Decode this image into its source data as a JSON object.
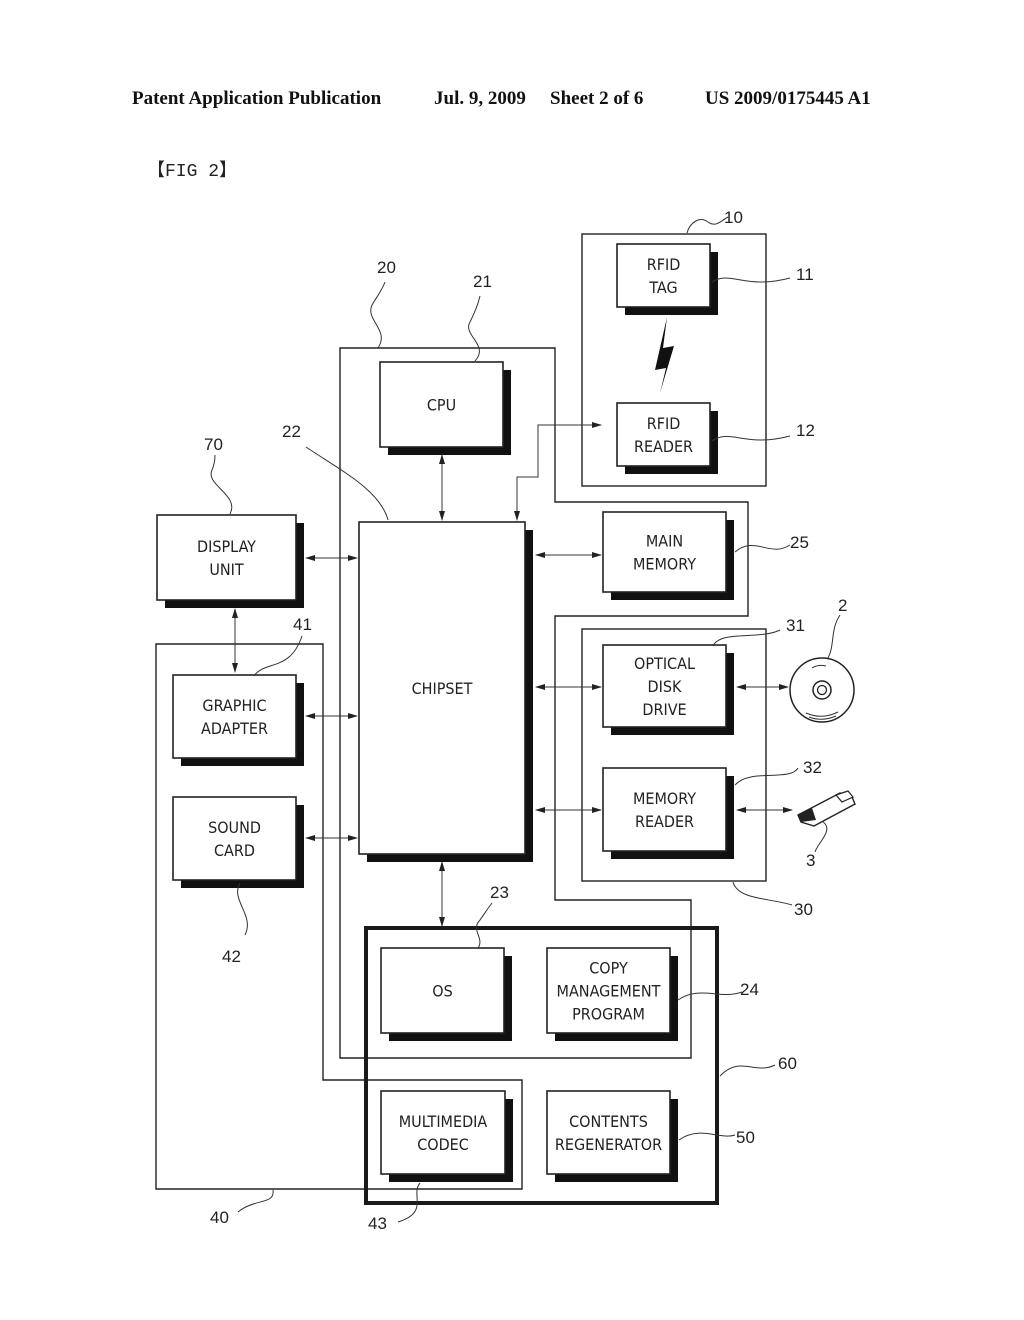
{
  "header": {
    "publication": "Patent Application Publication",
    "date": "Jul. 9, 2009",
    "sheet": "Sheet 2 of 6",
    "number": "US 2009/0175445 A1"
  },
  "figure_label": "【FIG 2】",
  "blocks": {
    "rfid_tag": {
      "lines": [
        "RFID",
        "TAG"
      ],
      "ref": "11"
    },
    "rfid_reader": {
      "lines": [
        "RFID",
        "READER"
      ],
      "ref": "12"
    },
    "cpu": {
      "lines": [
        "CPU"
      ],
      "ref": "21"
    },
    "chipset": {
      "lines": [
        "CHIPSET"
      ],
      "ref": "22"
    },
    "os": {
      "lines": [
        "OS"
      ],
      "ref": "23"
    },
    "copy_management": {
      "lines": [
        "COPY",
        "MANAGEMENT",
        "PROGRAM"
      ],
      "ref": "24"
    },
    "main_memory": {
      "lines": [
        "MAIN",
        "MEMORY"
      ],
      "ref": "25"
    },
    "optical_disk_drive": {
      "lines": [
        "OPTICAL",
        "DISK",
        "DRIVE"
      ],
      "ref": "31"
    },
    "memory_reader": {
      "lines": [
        "MEMORY",
        "READER"
      ],
      "ref": "32"
    },
    "graphic_adapter": {
      "lines": [
        "GRAPHIC",
        "ADAPTER"
      ],
      "ref": "41"
    },
    "sound_card": {
      "lines": [
        "SOUND",
        "CARD"
      ],
      "ref": "42"
    },
    "multimedia_codec": {
      "lines": [
        "MULTIMEDIA",
        "CODEC"
      ],
      "ref": "43"
    },
    "contents_regenerator": {
      "lines": [
        "CONTENTS",
        "REGENERATOR"
      ],
      "ref": "50"
    },
    "display_unit": {
      "lines": [
        "DISPLAY",
        "UNIT"
      ],
      "ref": "70"
    }
  },
  "containers": {
    "rfid_module": {
      "ref": "10"
    },
    "computer": {
      "ref": "20"
    },
    "storage_readers": {
      "ref": "30"
    },
    "av_module": {
      "ref": "40"
    },
    "software_area": {
      "ref": "60"
    }
  },
  "external": {
    "optical_disk": {
      "ref": "2",
      "icon": "cd-disc-icon"
    },
    "usb_memory": {
      "ref": "3",
      "icon": "usb-stick-icon"
    }
  }
}
